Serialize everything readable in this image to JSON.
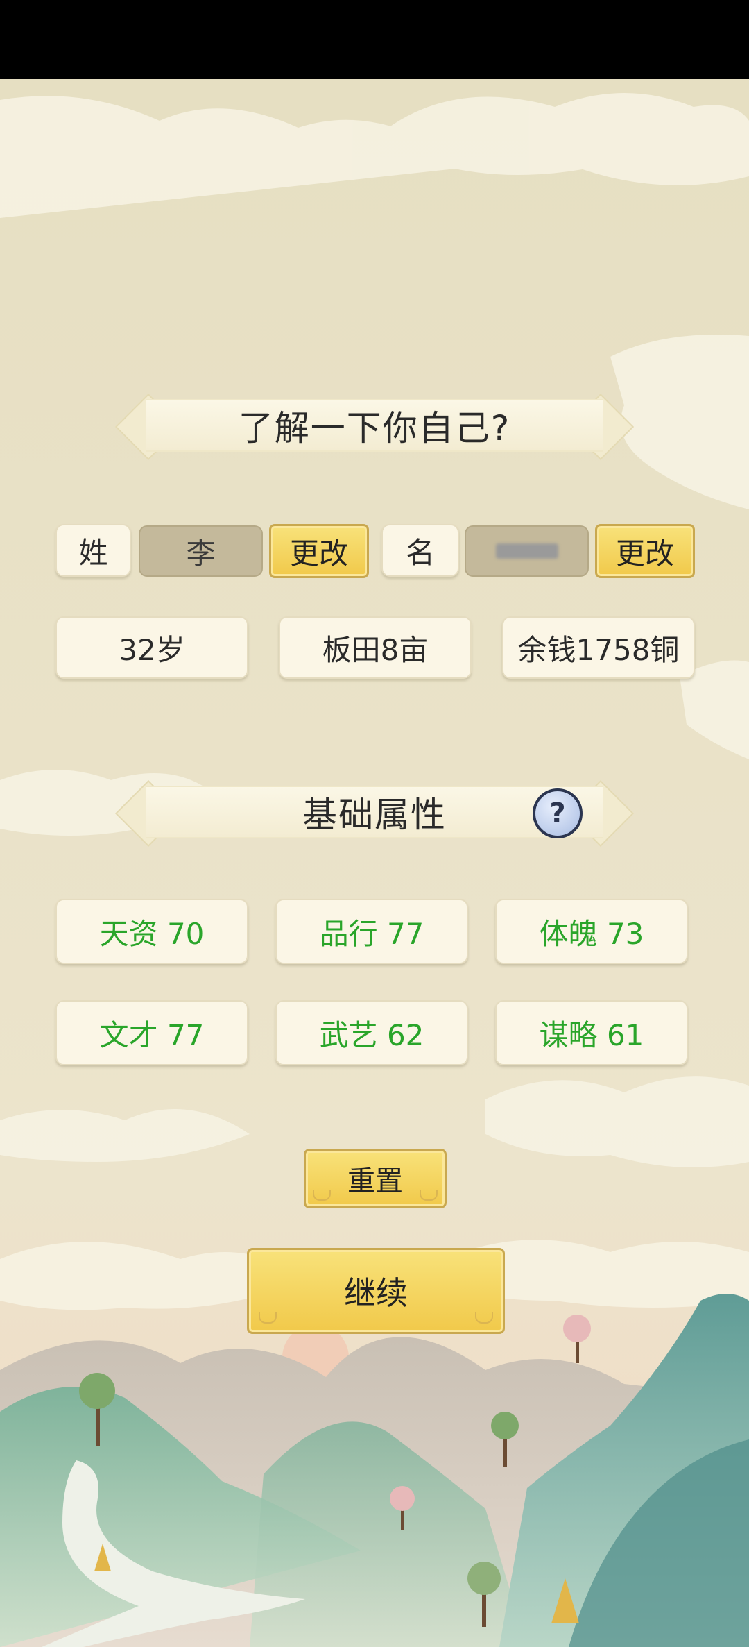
{
  "header": {
    "title": "了解一下你自己?"
  },
  "identity": {
    "surname_label": "姓",
    "surname_value": "李",
    "change_surname_label": "更改",
    "given_label": "名",
    "change_given_label": "更改"
  },
  "info": {
    "age": "32岁",
    "land": "板田8亩",
    "money": "余钱1758铜"
  },
  "attributes": {
    "title": "基础属性",
    "help_icon": "question-mark-icon",
    "items": [
      "天资 70",
      "品行 77",
      "体魄 73",
      "文才 77",
      "武艺 62",
      "谋略 61"
    ]
  },
  "actions": {
    "reset_label": "重置",
    "continue_label": "继续"
  },
  "colors": {
    "attribute_text": "#2aa52a",
    "gold_button": "#f1c94a",
    "background": "#e9e2c8"
  }
}
